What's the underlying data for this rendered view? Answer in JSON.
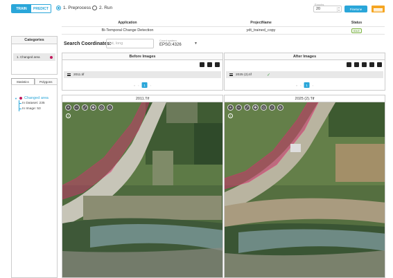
{
  "mode": {
    "train": "TRAIN",
    "predict": "PREDICT",
    "active": "predict"
  },
  "steps": [
    {
      "label": "1. Preprocess",
      "checked": true
    },
    {
      "label": "2. Run",
      "checked": false
    }
  ],
  "epochs": {
    "label": "Epochs",
    "value": "20"
  },
  "finetune": {
    "label": "Finetune"
  },
  "project": {
    "headers": [
      "Application",
      "ProjectName",
      "Status"
    ],
    "application": "Bi-Temporal Change Detection",
    "name": "ydt_trained_copy",
    "status": "IDLE"
  },
  "categories": {
    "title": "Categories",
    "items": [
      {
        "label": "1. Changed area",
        "color": "#c2185b"
      }
    ]
  },
  "tabs": {
    "statistics": "Statistics",
    "polygons": "Polygons"
  },
  "stats": {
    "root": "Changed area",
    "dataset": "In Dataset: 235",
    "image": "In Image: 53"
  },
  "search": {
    "label": "Search Coordinates:",
    "placeholder": "lat, long"
  },
  "coord": {
    "label": "Coord system",
    "value": "EPSG:4326"
  },
  "before": {
    "title": "Before Images",
    "file": "2011.tif",
    "page": "1"
  },
  "after": {
    "title": "After Images",
    "file": "2025 (2).tif",
    "page": "1"
  },
  "maps": {
    "left_title": "2011.Tif",
    "right_title": "2025 (2).Tif"
  }
}
